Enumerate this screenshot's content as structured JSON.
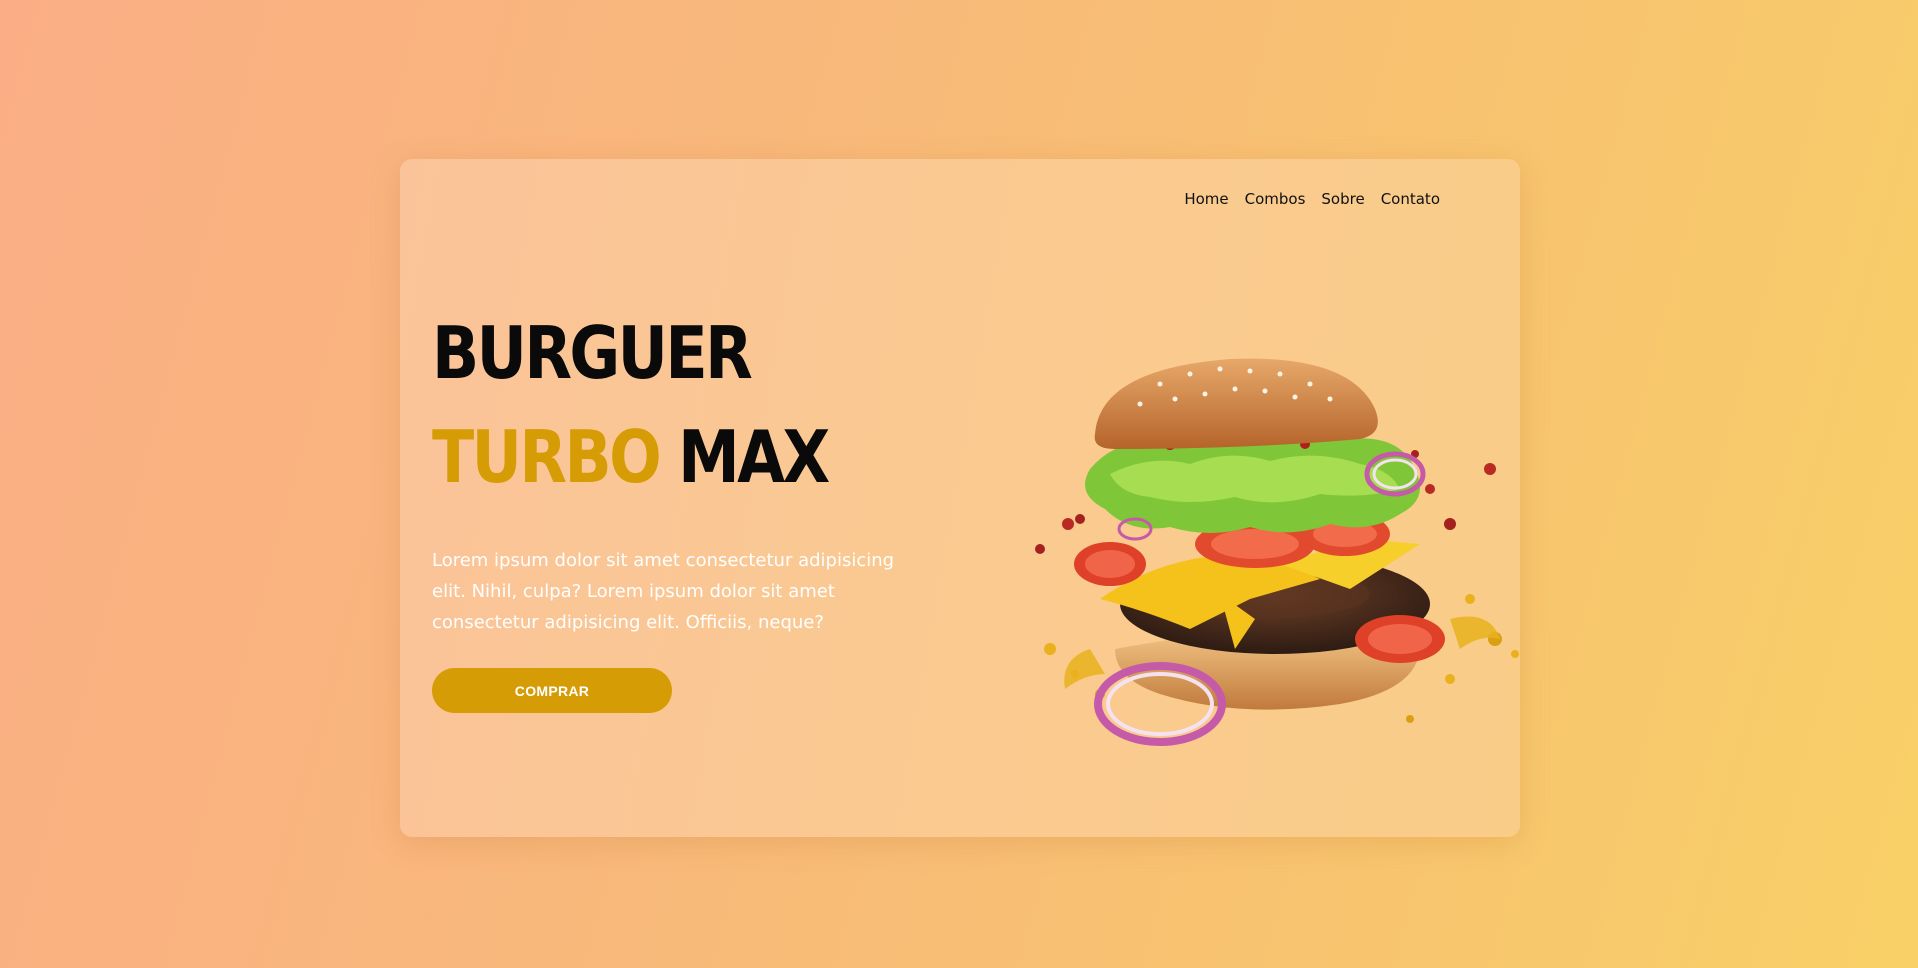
{
  "nav": {
    "items": [
      {
        "label": "Home"
      },
      {
        "label": "Combos"
      },
      {
        "label": "Sobre"
      },
      {
        "label": "Contato"
      }
    ]
  },
  "hero": {
    "title_line1": "BURGUER",
    "title_accent": "TURBO",
    "title_rest": "MAX",
    "description": "Lorem ipsum dolor sit amet consectetur adipisicing elit. Nihil, culpa? Lorem ipsum dolor sit amet consectetur adipisicing elit. Officiis, neque?",
    "button_label": "COMPRAR"
  },
  "colors": {
    "accent": "#d69c06",
    "text_dark": "#0a0a0a",
    "text_light": "#ffffff"
  },
  "icons": {
    "hero_image": "burger-illustration"
  }
}
